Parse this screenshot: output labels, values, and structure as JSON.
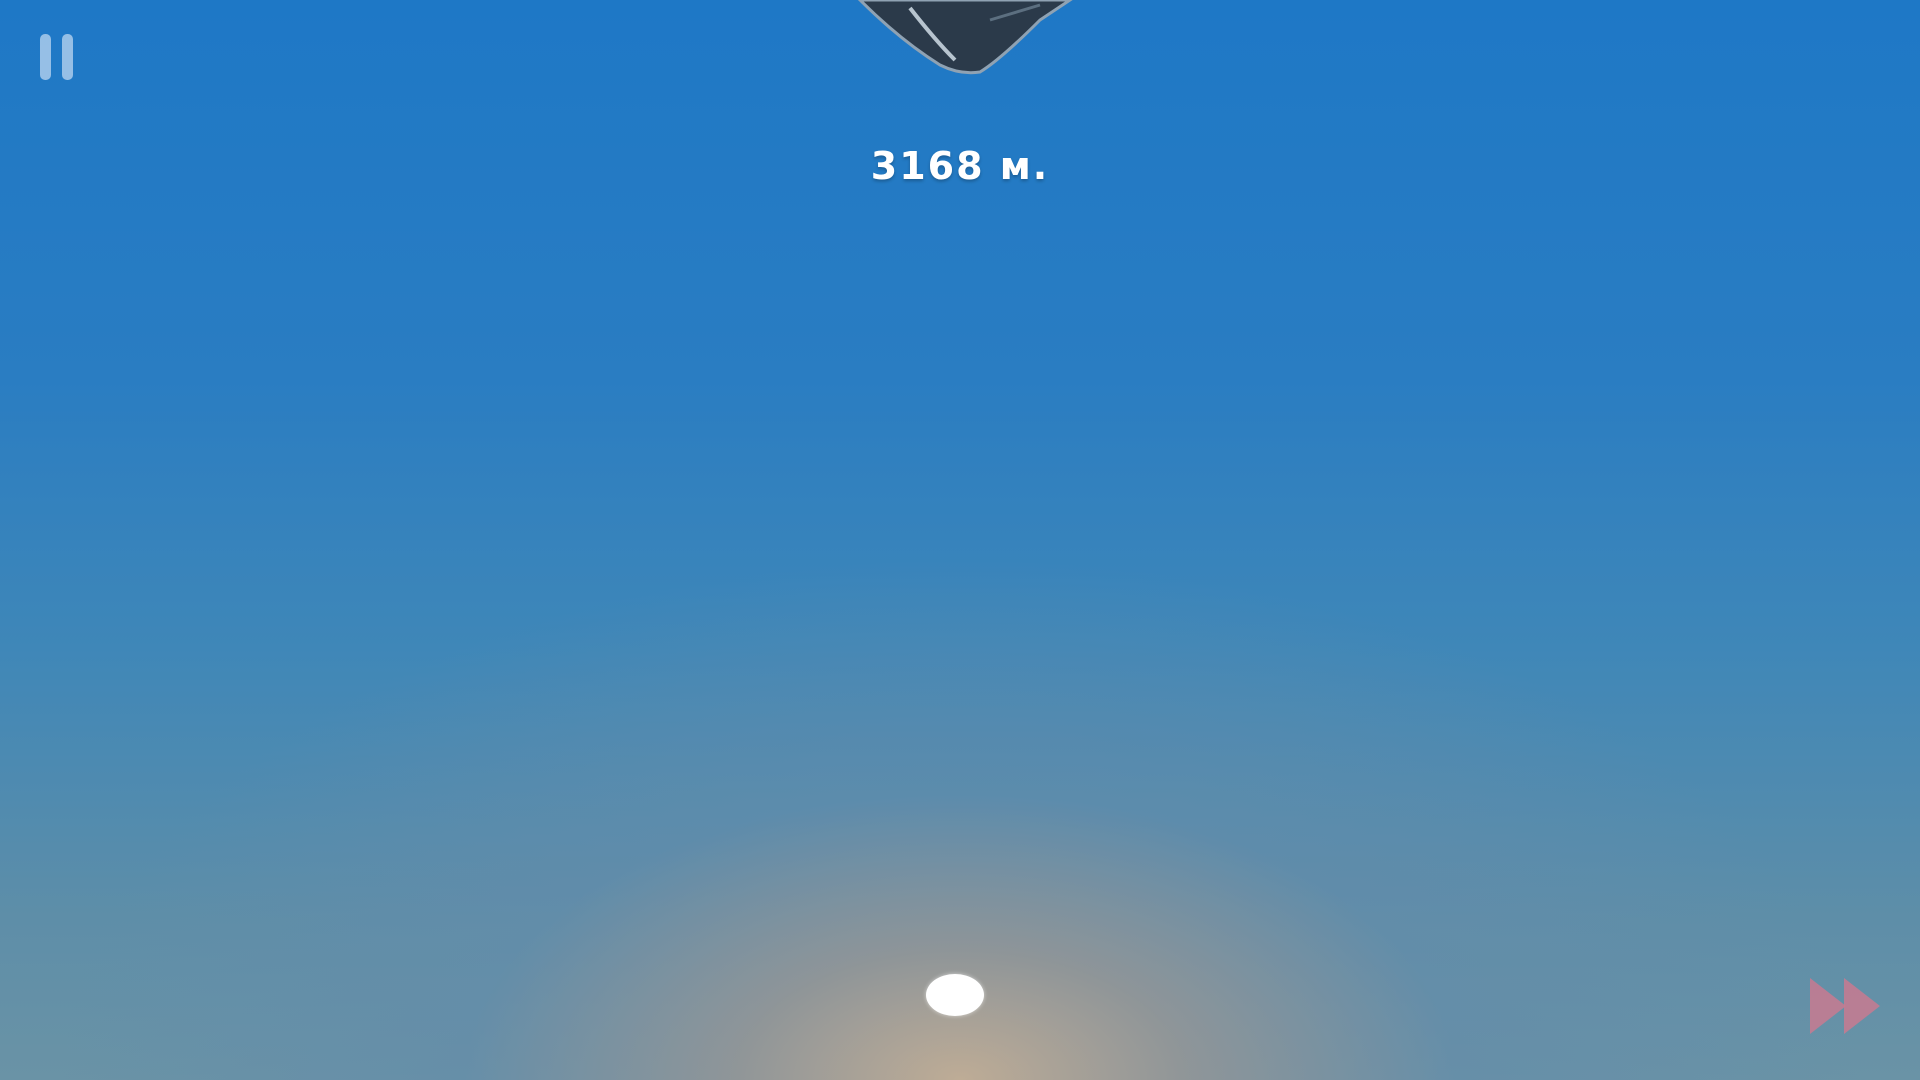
{
  "hud": {
    "distance_text": "3168 м.",
    "pause_icon": "pause-icon",
    "fast_forward_icon": "fast-forward-icon"
  },
  "colors": {
    "sky_top": "#1e78c6",
    "sky_horizon": "#bea c96",
    "pause_icon": "#bed7f0",
    "fast_forward_icon": "#c87a90",
    "distance_text": "#ffffff"
  }
}
